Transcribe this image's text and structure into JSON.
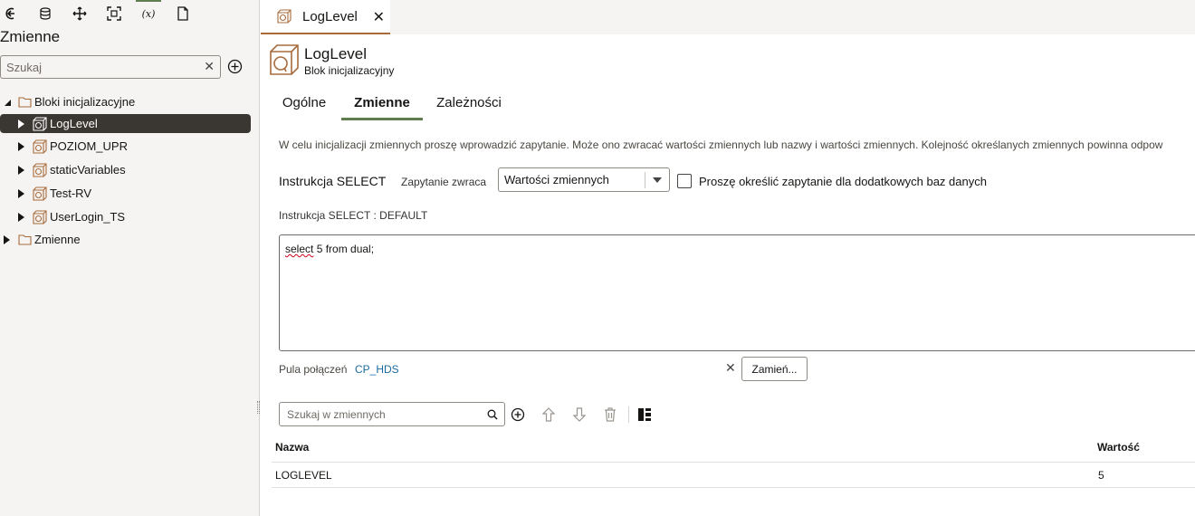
{
  "left_panel": {
    "title": "Zmienne",
    "search": {
      "placeholder": "Szukaj",
      "value": ""
    },
    "tree": [
      {
        "label": "Bloki inicjalizacyjne",
        "type": "folder",
        "expanded": true
      },
      {
        "label": "LogLevel",
        "type": "init-block",
        "selected": true
      },
      {
        "label": "POZIOM_UPR",
        "type": "init-block"
      },
      {
        "label": "staticVariables",
        "type": "init-block"
      },
      {
        "label": "Test-RV",
        "type": "init-block"
      },
      {
        "label": "UserLogin_TS",
        "type": "init-block"
      },
      {
        "label": "Zmienne",
        "type": "folder",
        "expanded": false
      }
    ]
  },
  "toolbar_icons": [
    "back-icon",
    "database-icon",
    "move-icon",
    "fit-icon",
    "variables-icon",
    "document-icon"
  ],
  "toolbar": {
    "fx_label": "(x)"
  },
  "tab": {
    "label": "LogLevel",
    "close": "✕"
  },
  "header": {
    "title": "LogLevel",
    "subtitle": "Blok inicjalizacyjny"
  },
  "subtabs": [
    {
      "label": "Ogólne",
      "active": false
    },
    {
      "label": "Zmienne",
      "active": true
    },
    {
      "label": "Zależności",
      "active": false
    }
  ],
  "description": "W celu inicjalizacji zmiennych proszę wprowadzić zapytanie. Może ono zwracać wartości zmiennych lub nazwy i wartości zmiennych. Kolejność określanych zmiennych powinna odpow",
  "select_section": {
    "label": "Instrukcja SELECT",
    "returns_label": "Zapytanie zwraca",
    "returns_value": "Wartości zmiennych",
    "checkbox_label": "Proszę określić zapytanie dla dodatkowych baz danych",
    "checkbox_checked": false,
    "default_label": "Instrukcja SELECT : DEFAULT",
    "sql_first_word": "select",
    "sql_rest": " 5 from dual;"
  },
  "connection_pool": {
    "label": "Pula połączeń",
    "value": "CP_HDS",
    "replace_button": "Zamień..."
  },
  "variables": {
    "search_placeholder": "Szukaj w zmiennych",
    "columns": {
      "name": "Nazwa",
      "value": "Wartość"
    },
    "rows": [
      {
        "name": "LOGLEVEL",
        "value": "5"
      }
    ]
  },
  "colors": {
    "accent_green": "#5f7d4f",
    "tab_underline": "#a86b3c",
    "selected_bg": "#3a3631",
    "link": "#1a6aa1"
  }
}
